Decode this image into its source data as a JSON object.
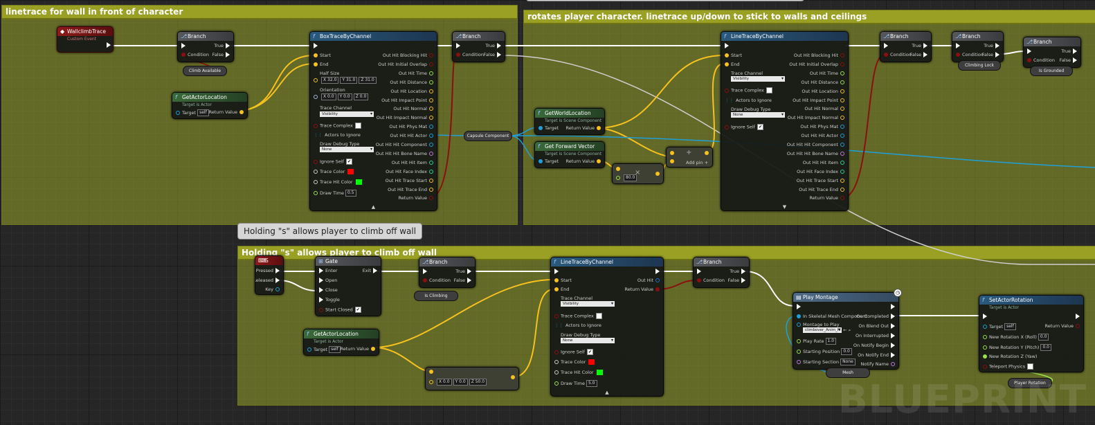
{
  "comments": {
    "c1": "linetrace for wall in front of character",
    "c2": "rotates player character. linetrace up/down to stick to walls and ceilings",
    "c3": "Holding \"s\" allows player to climb off wall",
    "bubble": "Holding \"s\" allows player to climb off wall"
  },
  "event": {
    "title": "WallclimbTrace",
    "sub": "Custom Event"
  },
  "branch": {
    "title": "Branch",
    "true": "True",
    "false": "False",
    "condition": "Condition"
  },
  "vars": {
    "climb_available": "Climb Available",
    "capsule": "Capsule Component",
    "climbing_lock": "Climbing Lock",
    "is_grounded": "Is Grounded",
    "is_climbing": "Is Climbing",
    "mesh": "Mesh",
    "player_rotation": "Player Rotation"
  },
  "get_actor_location": {
    "title": "GetActorLocation",
    "sub": "Target is Actor",
    "target": "Target",
    "self": "self",
    "ret": "Return Value"
  },
  "boxtrace": {
    "title": "BoxTraceByChannel",
    "start": "Start",
    "end": "End",
    "half_size": "Half Size",
    "hx": "32.0",
    "hy": "31.0",
    "hz": "31.0",
    "orientation": "Orientation",
    "ox": "0.0",
    "oy": "0.0",
    "oz": "0.0",
    "trace_channel": "Trace Channel",
    "channel_val": "Visibility",
    "trace_complex": "Trace Complex",
    "actors_ignore": "Actors to Ignore",
    "draw_debug": "Draw Debug Type",
    "debug_val": "None",
    "ignore_self": "Ignore Self",
    "trace_color": "Trace Color",
    "hit_color": "Trace Hit Color",
    "draw_time": "Draw Time",
    "draw_time_val": "0.5",
    "outputs": [
      "Out Hit Blocking Hit",
      "Out Hit Initial Overlap",
      "Out Hit Time",
      "Out Hit Distance",
      "Out Hit Location",
      "Out Hit Impact Point",
      "Out Hit Normal",
      "Out Hit Impact Normal",
      "Out Hit Phys Mat",
      "Out Hit Hit Actor",
      "Out Hit Hit Component",
      "Out Hit Hit Bone Name",
      "Out Hit Hit Item",
      "Out Hit Face Index",
      "Out Hit Trace Start",
      "Out Hit Trace End",
      "Return Value"
    ]
  },
  "linetrace_top": {
    "title": "LineTraceByChannel",
    "start": "Start",
    "end": "End",
    "trace_channel": "Trace Channel",
    "channel_val": "Visibility",
    "trace_complex": "Trace Complex",
    "actors_ignore": "Actors to Ignore",
    "draw_debug": "Draw Debug Type",
    "debug_val": "None",
    "ignore_self": "Ignore Self",
    "outputs": [
      "Out Hit Blocking Hit",
      "Out Hit Initial Overlap",
      "Out Hit Time",
      "Out Hit Distance",
      "Out Hit Location",
      "Out Hit Impact Point",
      "Out Hit Normal",
      "Out Hit Impact Normal",
      "Out Hit Phys Mat",
      "Out Hit Hit Actor",
      "Out Hit Hit Component",
      "Out Hit Hit Bone Name",
      "Out Hit Hit Item",
      "Out Hit Face Index",
      "Out Hit Trace Start",
      "Out Hit Trace End",
      "Return Value"
    ]
  },
  "world_loc": {
    "title": "GetWorldLocation",
    "sub": "Target is Scene Component",
    "target": "Target",
    "ret": "Return Value"
  },
  "fwd_vec": {
    "title": "Get Forward Vector",
    "sub": "Target is Scene Component",
    "target": "Target",
    "ret": "Return Value"
  },
  "mult": {
    "val": "80.0"
  },
  "add": {
    "label": "Add pin"
  },
  "key_s": {
    "title": "S",
    "pressed": "Pressed",
    "released": "Released",
    "key": "Key"
  },
  "gate": {
    "title": "Gate",
    "enter": "Enter",
    "exit": "Exit",
    "open": "Open",
    "close": "Close",
    "toggle": "Toggle",
    "start_closed": "Start Closed"
  },
  "linetrace_bot": {
    "title": "LineTraceByChannel",
    "start": "Start",
    "end": "End",
    "out_hit": "Out Hit",
    "ret": "Return Value",
    "trace_channel": "Trace Channel",
    "channel_val": "Visibility",
    "trace_complex": "Trace Complex",
    "actors_ignore": "Actors to Ignore",
    "draw_debug": "Draw Debug Type",
    "debug_val": "None",
    "ignore_self": "Ignore Self",
    "trace_color": "Trace Color",
    "hit_color": "Trace Hit Color",
    "draw_time": "Draw Time",
    "draw_time_val": "5.0"
  },
  "vec_add": {
    "x": "0.0",
    "y": "0.0",
    "z": "50.0"
  },
  "montage": {
    "title": "Play Montage",
    "in_mesh": "In Skeletal Mesh Component",
    "montage": "Montage to Play",
    "montage_val": "climbover_Anim_M",
    "play_rate": "Play Rate",
    "play_rate_val": "1.0",
    "start_pos": "Starting Position",
    "start_pos_val": "0.0",
    "start_sec": "Starting Section",
    "start_sec_val": "None",
    "on_completed": "On Completed",
    "on_blend_out": "On Blend Out",
    "on_interrupted": "On Interrupted",
    "notify_begin": "On Notify Begin",
    "notify_end": "On Notify End",
    "notify_name": "Notify Name"
  },
  "set_rot": {
    "title": "SetActorRotation",
    "sub": "Target is Actor",
    "target": "Target",
    "self": "self",
    "ret": "Return Value",
    "roll": "New Rotation X (Roll)",
    "pitch": "New Rotation Y (Pitch)",
    "yaw": "New Rotation Z (Yaw)",
    "roll_val": "0.0",
    "pitch_val": "0.0",
    "teleport": "Teleport Physics"
  },
  "watermark": "BLUEPRINT",
  "colors": {
    "exec": "#ffffff",
    "vector": "#f7c21e",
    "bool": "#8c0f0f",
    "object": "#1fa0d9",
    "comment": "#9aa024"
  }
}
